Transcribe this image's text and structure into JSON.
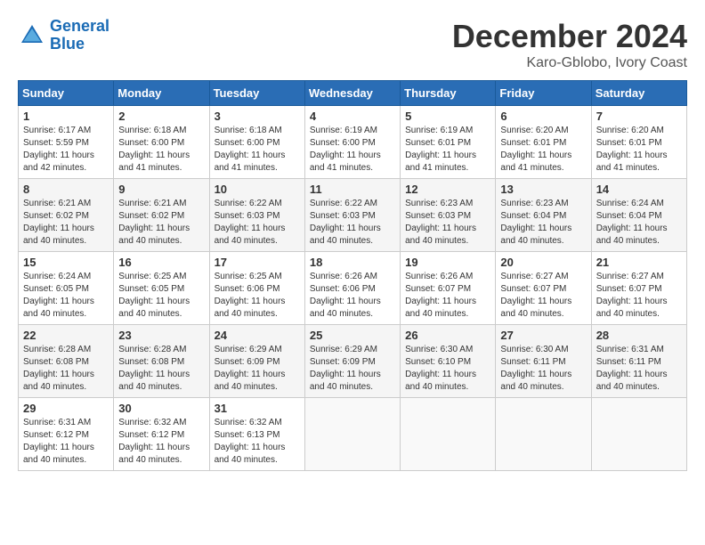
{
  "header": {
    "logo_line1": "General",
    "logo_line2": "Blue",
    "month_title": "December 2024",
    "location": "Karo-Gblobo, Ivory Coast"
  },
  "days_of_week": [
    "Sunday",
    "Monday",
    "Tuesday",
    "Wednesday",
    "Thursday",
    "Friday",
    "Saturday"
  ],
  "weeks": [
    [
      {
        "day": "1",
        "sunrise": "6:17 AM",
        "sunset": "5:59 PM",
        "daylight": "11 hours and 42 minutes."
      },
      {
        "day": "2",
        "sunrise": "6:18 AM",
        "sunset": "6:00 PM",
        "daylight": "11 hours and 41 minutes."
      },
      {
        "day": "3",
        "sunrise": "6:18 AM",
        "sunset": "6:00 PM",
        "daylight": "11 hours and 41 minutes."
      },
      {
        "day": "4",
        "sunrise": "6:19 AM",
        "sunset": "6:00 PM",
        "daylight": "11 hours and 41 minutes."
      },
      {
        "day": "5",
        "sunrise": "6:19 AM",
        "sunset": "6:01 PM",
        "daylight": "11 hours and 41 minutes."
      },
      {
        "day": "6",
        "sunrise": "6:20 AM",
        "sunset": "6:01 PM",
        "daylight": "11 hours and 41 minutes."
      },
      {
        "day": "7",
        "sunrise": "6:20 AM",
        "sunset": "6:01 PM",
        "daylight": "11 hours and 41 minutes."
      }
    ],
    [
      {
        "day": "8",
        "sunrise": "6:21 AM",
        "sunset": "6:02 PM",
        "daylight": "11 hours and 40 minutes."
      },
      {
        "day": "9",
        "sunrise": "6:21 AM",
        "sunset": "6:02 PM",
        "daylight": "11 hours and 40 minutes."
      },
      {
        "day": "10",
        "sunrise": "6:22 AM",
        "sunset": "6:03 PM",
        "daylight": "11 hours and 40 minutes."
      },
      {
        "day": "11",
        "sunrise": "6:22 AM",
        "sunset": "6:03 PM",
        "daylight": "11 hours and 40 minutes."
      },
      {
        "day": "12",
        "sunrise": "6:23 AM",
        "sunset": "6:03 PM",
        "daylight": "11 hours and 40 minutes."
      },
      {
        "day": "13",
        "sunrise": "6:23 AM",
        "sunset": "6:04 PM",
        "daylight": "11 hours and 40 minutes."
      },
      {
        "day": "14",
        "sunrise": "6:24 AM",
        "sunset": "6:04 PM",
        "daylight": "11 hours and 40 minutes."
      }
    ],
    [
      {
        "day": "15",
        "sunrise": "6:24 AM",
        "sunset": "6:05 PM",
        "daylight": "11 hours and 40 minutes."
      },
      {
        "day": "16",
        "sunrise": "6:25 AM",
        "sunset": "6:05 PM",
        "daylight": "11 hours and 40 minutes."
      },
      {
        "day": "17",
        "sunrise": "6:25 AM",
        "sunset": "6:06 PM",
        "daylight": "11 hours and 40 minutes."
      },
      {
        "day": "18",
        "sunrise": "6:26 AM",
        "sunset": "6:06 PM",
        "daylight": "11 hours and 40 minutes."
      },
      {
        "day": "19",
        "sunrise": "6:26 AM",
        "sunset": "6:07 PM",
        "daylight": "11 hours and 40 minutes."
      },
      {
        "day": "20",
        "sunrise": "6:27 AM",
        "sunset": "6:07 PM",
        "daylight": "11 hours and 40 minutes."
      },
      {
        "day": "21",
        "sunrise": "6:27 AM",
        "sunset": "6:07 PM",
        "daylight": "11 hours and 40 minutes."
      }
    ],
    [
      {
        "day": "22",
        "sunrise": "6:28 AM",
        "sunset": "6:08 PM",
        "daylight": "11 hours and 40 minutes."
      },
      {
        "day": "23",
        "sunrise": "6:28 AM",
        "sunset": "6:08 PM",
        "daylight": "11 hours and 40 minutes."
      },
      {
        "day": "24",
        "sunrise": "6:29 AM",
        "sunset": "6:09 PM",
        "daylight": "11 hours and 40 minutes."
      },
      {
        "day": "25",
        "sunrise": "6:29 AM",
        "sunset": "6:09 PM",
        "daylight": "11 hours and 40 minutes."
      },
      {
        "day": "26",
        "sunrise": "6:30 AM",
        "sunset": "6:10 PM",
        "daylight": "11 hours and 40 minutes."
      },
      {
        "day": "27",
        "sunrise": "6:30 AM",
        "sunset": "6:11 PM",
        "daylight": "11 hours and 40 minutes."
      },
      {
        "day": "28",
        "sunrise": "6:31 AM",
        "sunset": "6:11 PM",
        "daylight": "11 hours and 40 minutes."
      }
    ],
    [
      {
        "day": "29",
        "sunrise": "6:31 AM",
        "sunset": "6:12 PM",
        "daylight": "11 hours and 40 minutes."
      },
      {
        "day": "30",
        "sunrise": "6:32 AM",
        "sunset": "6:12 PM",
        "daylight": "11 hours and 40 minutes."
      },
      {
        "day": "31",
        "sunrise": "6:32 AM",
        "sunset": "6:13 PM",
        "daylight": "11 hours and 40 minutes."
      },
      null,
      null,
      null,
      null
    ]
  ]
}
